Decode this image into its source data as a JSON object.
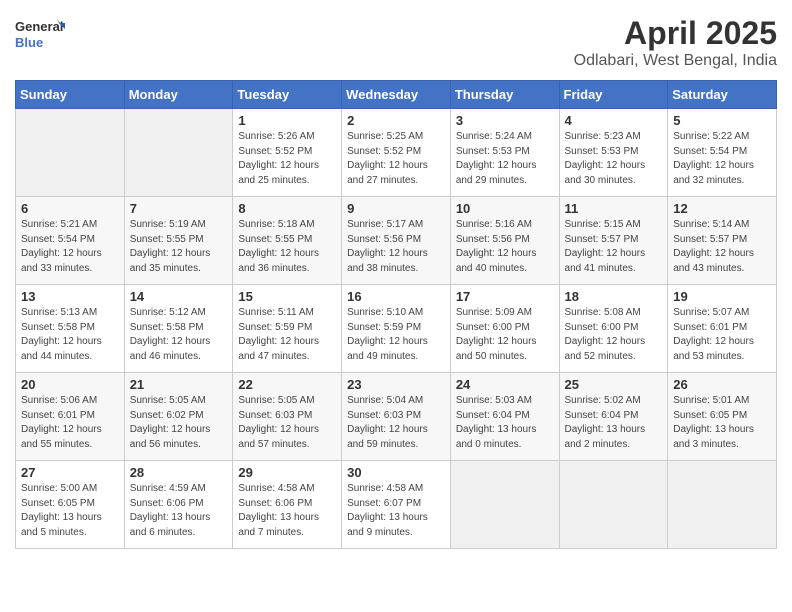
{
  "logo": {
    "line1": "General",
    "line2": "Blue"
  },
  "title": "April 2025",
  "subtitle": "Odlabari, West Bengal, India",
  "headers": [
    "Sunday",
    "Monday",
    "Tuesday",
    "Wednesday",
    "Thursday",
    "Friday",
    "Saturday"
  ],
  "weeks": [
    [
      {
        "num": "",
        "sunrise": "",
        "sunset": "",
        "daylight": ""
      },
      {
        "num": "",
        "sunrise": "",
        "sunset": "",
        "daylight": ""
      },
      {
        "num": "1",
        "sunrise": "Sunrise: 5:26 AM",
        "sunset": "Sunset: 5:52 PM",
        "daylight": "Daylight: 12 hours and 25 minutes."
      },
      {
        "num": "2",
        "sunrise": "Sunrise: 5:25 AM",
        "sunset": "Sunset: 5:52 PM",
        "daylight": "Daylight: 12 hours and 27 minutes."
      },
      {
        "num": "3",
        "sunrise": "Sunrise: 5:24 AM",
        "sunset": "Sunset: 5:53 PM",
        "daylight": "Daylight: 12 hours and 29 minutes."
      },
      {
        "num": "4",
        "sunrise": "Sunrise: 5:23 AM",
        "sunset": "Sunset: 5:53 PM",
        "daylight": "Daylight: 12 hours and 30 minutes."
      },
      {
        "num": "5",
        "sunrise": "Sunrise: 5:22 AM",
        "sunset": "Sunset: 5:54 PM",
        "daylight": "Daylight: 12 hours and 32 minutes."
      }
    ],
    [
      {
        "num": "6",
        "sunrise": "Sunrise: 5:21 AM",
        "sunset": "Sunset: 5:54 PM",
        "daylight": "Daylight: 12 hours and 33 minutes."
      },
      {
        "num": "7",
        "sunrise": "Sunrise: 5:19 AM",
        "sunset": "Sunset: 5:55 PM",
        "daylight": "Daylight: 12 hours and 35 minutes."
      },
      {
        "num": "8",
        "sunrise": "Sunrise: 5:18 AM",
        "sunset": "Sunset: 5:55 PM",
        "daylight": "Daylight: 12 hours and 36 minutes."
      },
      {
        "num": "9",
        "sunrise": "Sunrise: 5:17 AM",
        "sunset": "Sunset: 5:56 PM",
        "daylight": "Daylight: 12 hours and 38 minutes."
      },
      {
        "num": "10",
        "sunrise": "Sunrise: 5:16 AM",
        "sunset": "Sunset: 5:56 PM",
        "daylight": "Daylight: 12 hours and 40 minutes."
      },
      {
        "num": "11",
        "sunrise": "Sunrise: 5:15 AM",
        "sunset": "Sunset: 5:57 PM",
        "daylight": "Daylight: 12 hours and 41 minutes."
      },
      {
        "num": "12",
        "sunrise": "Sunrise: 5:14 AM",
        "sunset": "Sunset: 5:57 PM",
        "daylight": "Daylight: 12 hours and 43 minutes."
      }
    ],
    [
      {
        "num": "13",
        "sunrise": "Sunrise: 5:13 AM",
        "sunset": "Sunset: 5:58 PM",
        "daylight": "Daylight: 12 hours and 44 minutes."
      },
      {
        "num": "14",
        "sunrise": "Sunrise: 5:12 AM",
        "sunset": "Sunset: 5:58 PM",
        "daylight": "Daylight: 12 hours and 46 minutes."
      },
      {
        "num": "15",
        "sunrise": "Sunrise: 5:11 AM",
        "sunset": "Sunset: 5:59 PM",
        "daylight": "Daylight: 12 hours and 47 minutes."
      },
      {
        "num": "16",
        "sunrise": "Sunrise: 5:10 AM",
        "sunset": "Sunset: 5:59 PM",
        "daylight": "Daylight: 12 hours and 49 minutes."
      },
      {
        "num": "17",
        "sunrise": "Sunrise: 5:09 AM",
        "sunset": "Sunset: 6:00 PM",
        "daylight": "Daylight: 12 hours and 50 minutes."
      },
      {
        "num": "18",
        "sunrise": "Sunrise: 5:08 AM",
        "sunset": "Sunset: 6:00 PM",
        "daylight": "Daylight: 12 hours and 52 minutes."
      },
      {
        "num": "19",
        "sunrise": "Sunrise: 5:07 AM",
        "sunset": "Sunset: 6:01 PM",
        "daylight": "Daylight: 12 hours and 53 minutes."
      }
    ],
    [
      {
        "num": "20",
        "sunrise": "Sunrise: 5:06 AM",
        "sunset": "Sunset: 6:01 PM",
        "daylight": "Daylight: 12 hours and 55 minutes."
      },
      {
        "num": "21",
        "sunrise": "Sunrise: 5:05 AM",
        "sunset": "Sunset: 6:02 PM",
        "daylight": "Daylight: 12 hours and 56 minutes."
      },
      {
        "num": "22",
        "sunrise": "Sunrise: 5:05 AM",
        "sunset": "Sunset: 6:03 PM",
        "daylight": "Daylight: 12 hours and 57 minutes."
      },
      {
        "num": "23",
        "sunrise": "Sunrise: 5:04 AM",
        "sunset": "Sunset: 6:03 PM",
        "daylight": "Daylight: 12 hours and 59 minutes."
      },
      {
        "num": "24",
        "sunrise": "Sunrise: 5:03 AM",
        "sunset": "Sunset: 6:04 PM",
        "daylight": "Daylight: 13 hours and 0 minutes."
      },
      {
        "num": "25",
        "sunrise": "Sunrise: 5:02 AM",
        "sunset": "Sunset: 6:04 PM",
        "daylight": "Daylight: 13 hours and 2 minutes."
      },
      {
        "num": "26",
        "sunrise": "Sunrise: 5:01 AM",
        "sunset": "Sunset: 6:05 PM",
        "daylight": "Daylight: 13 hours and 3 minutes."
      }
    ],
    [
      {
        "num": "27",
        "sunrise": "Sunrise: 5:00 AM",
        "sunset": "Sunset: 6:05 PM",
        "daylight": "Daylight: 13 hours and 5 minutes."
      },
      {
        "num": "28",
        "sunrise": "Sunrise: 4:59 AM",
        "sunset": "Sunset: 6:06 PM",
        "daylight": "Daylight: 13 hours and 6 minutes."
      },
      {
        "num": "29",
        "sunrise": "Sunrise: 4:58 AM",
        "sunset": "Sunset: 6:06 PM",
        "daylight": "Daylight: 13 hours and 7 minutes."
      },
      {
        "num": "30",
        "sunrise": "Sunrise: 4:58 AM",
        "sunset": "Sunset: 6:07 PM",
        "daylight": "Daylight: 13 hours and 9 minutes."
      },
      {
        "num": "",
        "sunrise": "",
        "sunset": "",
        "daylight": ""
      },
      {
        "num": "",
        "sunrise": "",
        "sunset": "",
        "daylight": ""
      },
      {
        "num": "",
        "sunrise": "",
        "sunset": "",
        "daylight": ""
      }
    ]
  ]
}
